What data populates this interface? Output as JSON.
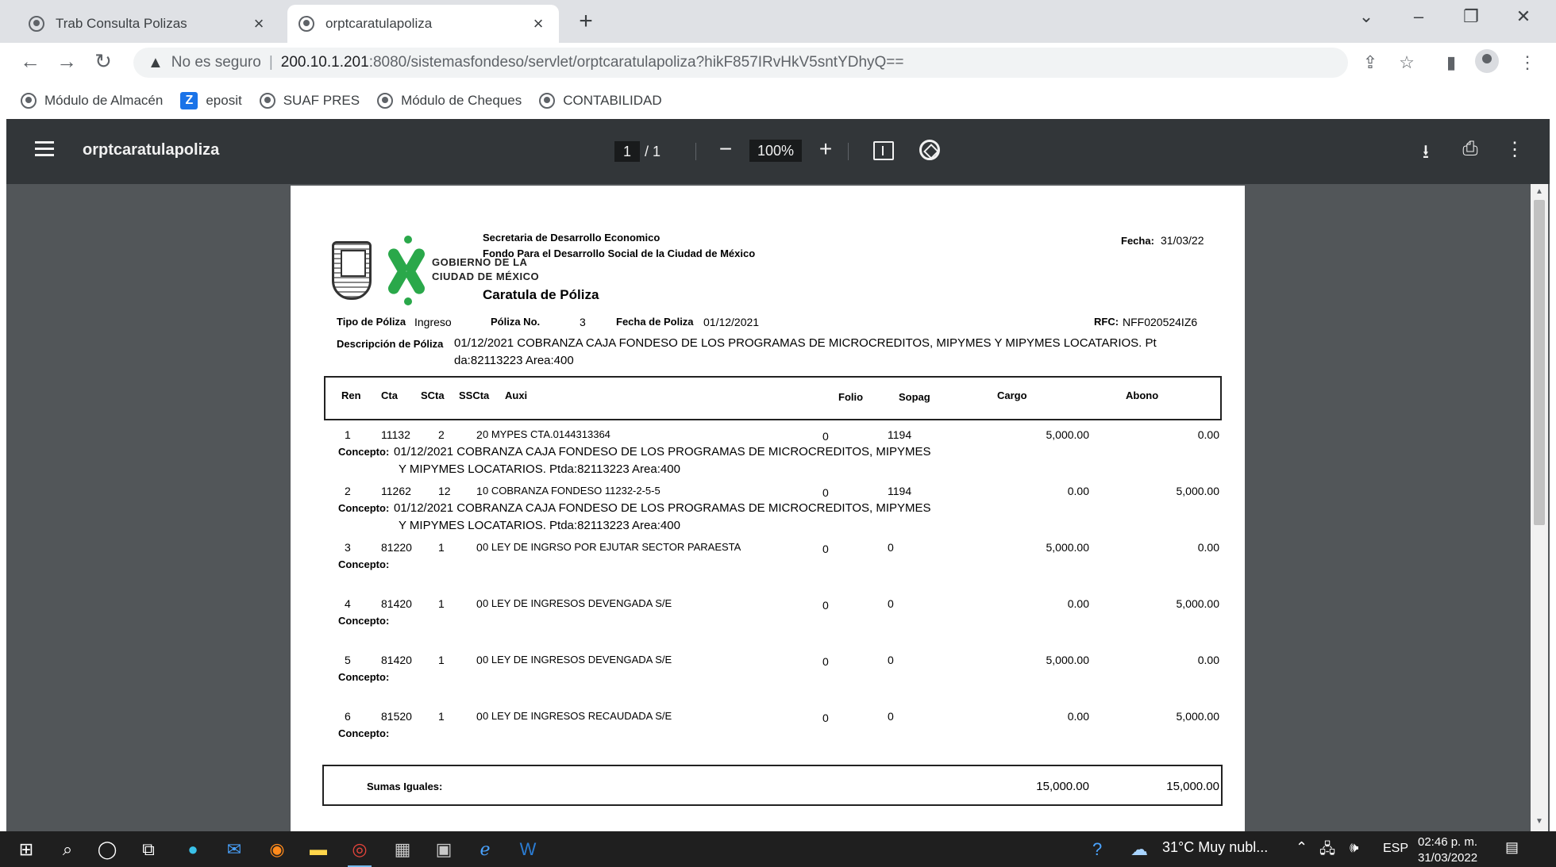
{
  "browser": {
    "tabs": [
      {
        "title": "Trab Consulta Polizas"
      },
      {
        "title": "orptcaratulapoliza"
      }
    ],
    "address": {
      "security": "No es seguro",
      "host": "200.10.1.201",
      "rest": ":8080/sistemasfondeso/servlet/orptcaratulapoliza?hikF857IRvHkV5sntYDhyQ=="
    },
    "bookmarks": [
      "Módulo de Almacén",
      "eposit",
      "SUAF PRES",
      "Módulo de Cheques",
      "CONTABILIDAD"
    ]
  },
  "viewer": {
    "title": "orptcaratulapoliza",
    "page_current": "1",
    "page_total": "/ 1",
    "zoom": "100%"
  },
  "document": {
    "org_line1": "Secretaria de Desarrollo Economico",
    "org_line2": "Fondo Para el Desarrollo Social de la Ciudad de México",
    "logo_text_line1": "GOBIERNO DE LA",
    "logo_text_line2": "CIUDAD DE MÉXICO",
    "doc_title": "Caratula de Póliza",
    "fecha_label": "Fecha:",
    "fecha_value": "31/03/22",
    "tipo_label": "Tipo de Póliza",
    "tipo_value": "Ingreso",
    "poliza_no_label": "Póliza No.",
    "poliza_no_value": "3",
    "fecha_poliza_label": "Fecha de Poliza",
    "fecha_poliza_value": "01/12/2021",
    "rfc_label": "RFC:",
    "rfc_value": "NFF020524IZ6",
    "desc_label": "Descripción de Póliza",
    "desc_line1": "01/12/2021 COBRANZA CAJA FONDESO DE LOS PROGRAMAS DE MICROCREDITOS, MIPYMES Y MIPYMES LOCATARIOS. Pt",
    "desc_line2": "da:82113223 Area:400",
    "columns": [
      "Ren",
      "Cta",
      "SCta",
      "SSCta",
      "Auxi",
      "Folio",
      "Sopag",
      "Cargo",
      "Abono"
    ],
    "concepto_label": "Concepto:",
    "rows": [
      {
        "ren": "1",
        "cta": "11132",
        "scta": "2",
        "sscta": "2",
        "auxi": "0 MYPES CTA.0144313364",
        "folio": "0",
        "sopag": "1194",
        "cargo": "5,000.00",
        "abono": "0.00",
        "concepto1": "01/12/2021 COBRANZA CAJA FONDESO DE LOS PROGRAMAS DE MICROCREDITOS, MIPYMES",
        "concepto2": "Y MIPYMES LOCATARIOS. Ptda:82113223 Area:400"
      },
      {
        "ren": "2",
        "cta": "11262",
        "scta": "12",
        "sscta": "1",
        "auxi": "0 COBRANZA FONDESO 11232-2-5-5",
        "folio": "0",
        "sopag": "1194",
        "cargo": "0.00",
        "abono": "5,000.00",
        "concepto1": "01/12/2021 COBRANZA CAJA FONDESO DE LOS PROGRAMAS DE MICROCREDITOS, MIPYMES",
        "concepto2": "Y MIPYMES LOCATARIOS. Ptda:82113223 Area:400"
      },
      {
        "ren": "3",
        "cta": "81220",
        "scta": "1",
        "sscta": "0",
        "auxi": "0 LEY DE INGRSO POR EJUTAR SECTOR PARAESTA",
        "folio": "0",
        "sopag": "0",
        "cargo": "5,000.00",
        "abono": "0.00",
        "concepto1": "",
        "concepto2": ""
      },
      {
        "ren": "4",
        "cta": "81420",
        "scta": "1",
        "sscta": "0",
        "auxi": "0 LEY DE INGRESOS DEVENGADA S/E",
        "folio": "0",
        "sopag": "0",
        "cargo": "0.00",
        "abono": "5,000.00",
        "concepto1": "",
        "concepto2": ""
      },
      {
        "ren": "5",
        "cta": "81420",
        "scta": "1",
        "sscta": "0",
        "auxi": "0 LEY DE INGRESOS DEVENGADA S/E",
        "folio": "0",
        "sopag": "0",
        "cargo": "5,000.00",
        "abono": "0.00",
        "concepto1": "",
        "concepto2": ""
      },
      {
        "ren": "6",
        "cta": "81520",
        "scta": "1",
        "sscta": "0",
        "auxi": "0 LEY DE INGRESOS RECAUDADA S/E",
        "folio": "0",
        "sopag": "0",
        "cargo": "0.00",
        "abono": "5,000.00",
        "concepto1": "",
        "concepto2": ""
      }
    ],
    "sumas_label": "Sumas Iguales:",
    "sumas_cargo": "15,000.00",
    "sumas_abono": "15,000.00"
  },
  "taskbar": {
    "weather": "31°C  Muy nubl...",
    "lang": "ESP",
    "time": "02:46 p. m.",
    "date": "31/03/2022"
  }
}
